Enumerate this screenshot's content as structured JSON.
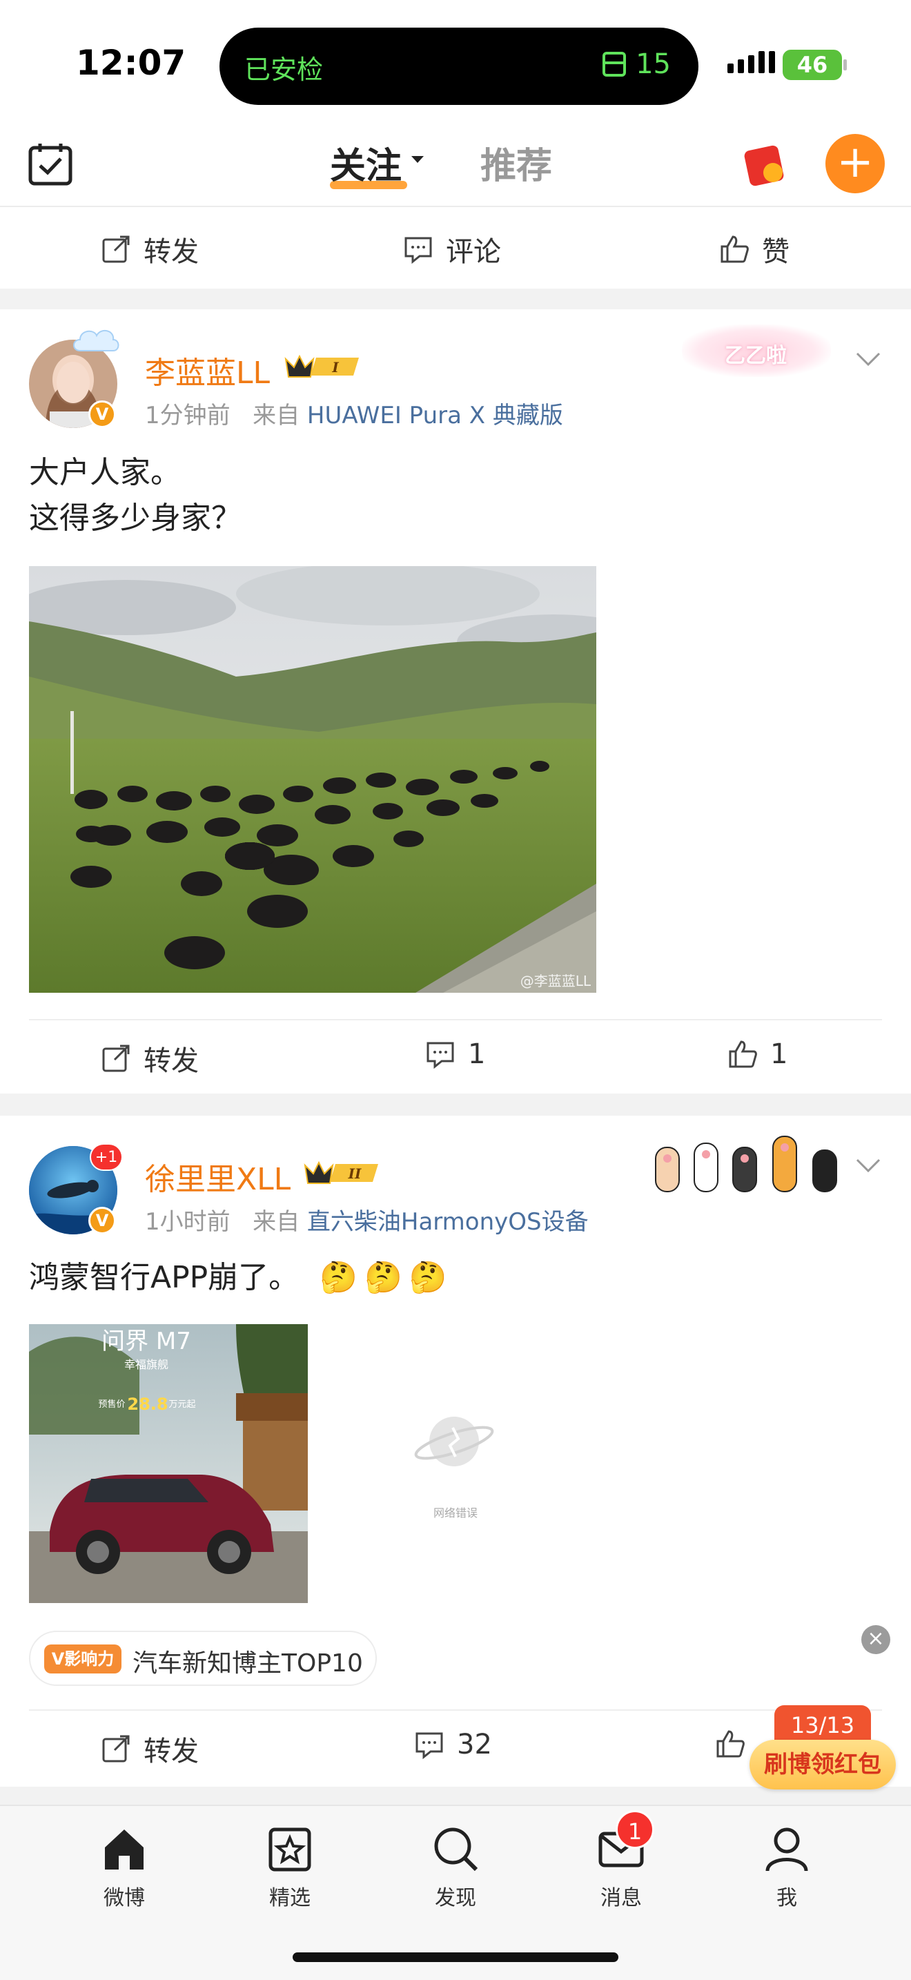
{
  "status_bar": {
    "time": "12:07",
    "island_left": "已安检",
    "island_right_count": "15",
    "battery": "46"
  },
  "top_nav": {
    "tab_follow": "关注",
    "tab_recommend": "推荐"
  },
  "prev_post_actions": {
    "repost": "转发",
    "comment": "评论",
    "like": "赞"
  },
  "post1": {
    "username": "李蓝蓝LL",
    "level": "I",
    "time": "1分钟前",
    "source_prefix": "来自",
    "source": "HUAWEI Pura X 典藏版",
    "decoration_text": "乙乙啦",
    "text_line1": "大户人家。",
    "text_line2": "这得多少身家？",
    "image_watermark": "@李蓝蓝LL",
    "repost": "转发",
    "comments": "1",
    "likes": "1"
  },
  "post2": {
    "username": "徐里里XLL",
    "level": "II",
    "avatar_badge": "+1",
    "time": "1小时前",
    "source_prefix": "来自",
    "source": "直六柴油HarmonyOS设备",
    "text": "鸿蒙智行APP崩了。",
    "emoji": [
      "🤔",
      "🤔",
      "🤔"
    ],
    "image1_title": "问界 M7",
    "image1_sub": "幸福旗舰",
    "image1_price_label": "预售价",
    "image1_price": "28.8",
    "image1_price_unit": "万元起",
    "image2_error": "网络错误",
    "influence_tag": "V影响力",
    "influence_text": "汽车新知博主TOP10",
    "repost": "转发",
    "comments": "32"
  },
  "floater": {
    "count": "13/13",
    "label": "刷博领红包"
  },
  "tab_bar": {
    "items": [
      "微博",
      "精选",
      "发现",
      "消息",
      "我"
    ],
    "message_badge": "1"
  },
  "colors": {
    "accent": "#ff8b1f",
    "username": "#f07a14",
    "link": "#4a6f9e"
  }
}
